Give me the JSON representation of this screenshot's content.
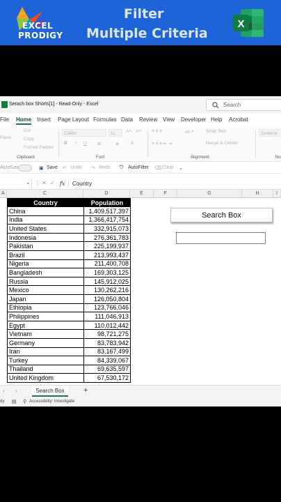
{
  "banner": {
    "logo_line1": "EXCEL",
    "logo_line2": "PRODIGY",
    "title_line1": "Filter",
    "title_line2": "Multiple Criteria",
    "excel_icon_letter": "X",
    "brand_color": "#1f63d8"
  },
  "window": {
    "title": "Serach box Shorts[1]  -  Read-Only  -  Excel",
    "search_placeholder": "Search"
  },
  "tabs": [
    "File",
    "Home",
    "Insert",
    "Page Layout",
    "Formulas",
    "Data",
    "Review",
    "View",
    "Developer",
    "Help",
    "Acrobat"
  ],
  "ribbon": {
    "cut": "Cut",
    "copy": "Copy",
    "format_painter": "Format Painter",
    "paste": "Paste",
    "font_name": "Calibri",
    "font_size": "11",
    "wrap_text": "Wrap Text",
    "merge_center": "Merge & Center",
    "number_format": "General",
    "groups": [
      "Clipboard",
      "Font",
      "Alignment",
      "Nu"
    ]
  },
  "qat": {
    "autosave": "AutoSave",
    "save": "Save",
    "undo": "Undo",
    "redo": "Redo",
    "autofilter": "AutoFilter",
    "clear": "Clear"
  },
  "formula_bar": {
    "fx": "fx",
    "value": "Country"
  },
  "columns": [
    "A",
    "E",
    "C",
    "D",
    "E",
    "F",
    "G",
    "H",
    "I"
  ],
  "table": {
    "headers": [
      "Country",
      "Population"
    ],
    "rows": [
      [
        "China",
        "1,409,517,397"
      ],
      [
        "India",
        "1,366,417,754"
      ],
      [
        "United States",
        "332,915,073"
      ],
      [
        "Indonesia",
        "276,361,783"
      ],
      [
        "Pakistan",
        "225,199,937"
      ],
      [
        "Brazil",
        "213,993,437"
      ],
      [
        "Nigeria",
        "211,400,708"
      ],
      [
        "Bangladesh",
        "169,303,125"
      ],
      [
        "Russia",
        "145,912,025"
      ],
      [
        "Mexico",
        "130,262,216"
      ],
      [
        "Japan",
        "126,050,804"
      ],
      [
        "Ethiopia",
        "123,766,046"
      ],
      [
        "Philippines",
        "111,046,913"
      ],
      [
        "Egypt",
        "110,012,442"
      ],
      [
        "Vietnam",
        "98,721,275"
      ],
      [
        "Germany",
        "83,783,942"
      ],
      [
        "Iran",
        "83,167,499"
      ],
      [
        "Turkey",
        "84,339,067"
      ],
      [
        "Thailand",
        "69,635,597"
      ],
      [
        "United Kingdom",
        "67,530,172"
      ]
    ]
  },
  "search_box_button": "Search Box",
  "sheet_tab": "Search Box",
  "add_sheet": "+",
  "status": {
    "ready": "dy",
    "accessibility": "Accessibility: Investigate"
  }
}
